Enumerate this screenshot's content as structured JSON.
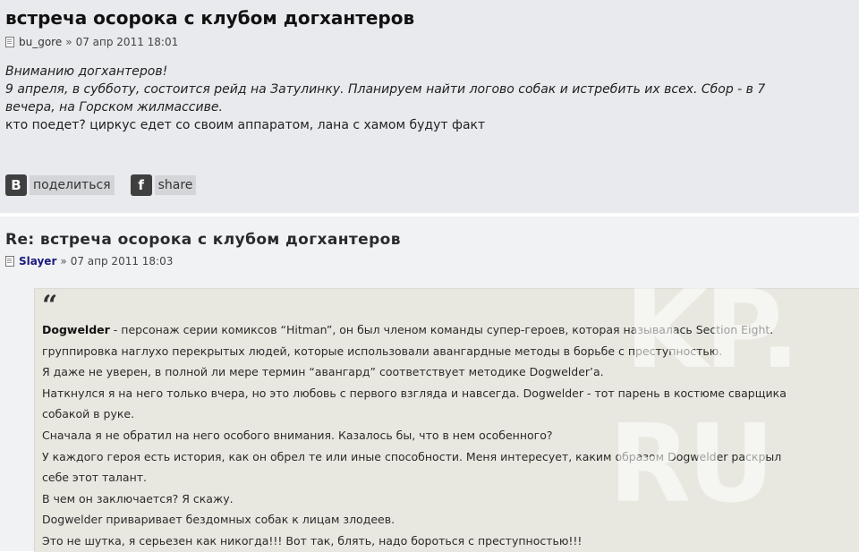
{
  "post1": {
    "title": "встреча осорока с клубом догхантеров",
    "author": "bu_gore",
    "separator": "»",
    "date": "07 апр 2011 18:01",
    "lines": [
      "Вниманию догхантеров!",
      "9 апреля, в субботу, состоится рейд на Затулинку. Планируем найти логово собак и истребить их всех. Сбор - в 7",
      "вечера, на Горском жилмассиве.",
      "кто поедет? циркус едет со своим аппаратом, лана с хамом будут факт"
    ],
    "share": {
      "vk_icon": "В",
      "vk_label": "поделиться",
      "fb_icon": "f",
      "fb_label": "share"
    }
  },
  "post2": {
    "title": "Re: встреча осорока с клубом догхантеров",
    "author": "Slayer",
    "separator": "»",
    "date": "07 апр 2011 18:03",
    "quote": {
      "mark": "“",
      "first_bold": "Dogwelder",
      "lines": [
        " - персонаж серии комиксов “Hitman”, он был членом команды супер-героев, которая называлась Section Eight.",
        "группировка наглухо перекрытых людей, которые использовали авангардные методы в борьбе с преступностью.",
        "Я даже не уверен, в полной ли мере термин “авангард” соответствует методике Dogwelder’a.",
        "Наткнулся я на него только вчера, но это любовь с первого взгляда и навсегда. Dogwelder - тот парень в костюме сварщика",
        "собакой в руке.",
        "Сначала я не обратил на него особого внимания. Казалось бы, что в нем особенного?",
        "У каждого героя есть история, как он обрел те или иные способности. Меня интересует, каким образом Dogwelder раскрыл",
        "себе этот талант.",
        "В чем он заключается? Я скажу.",
        "Dogwelder приваривает бездомных собак к лицам злодеев.",
        "Это не шутка, я серьезен как никогда!!! Вот так, блять, надо бороться с преступностью!!!"
      ]
    }
  },
  "watermark": {
    "line1": "KP.",
    "line2": "RU"
  },
  "colors": {
    "post_bg": "#e9eaed",
    "reply_bg": "#f1f2f4",
    "quote_bg": "#e9e8e0",
    "author_link": "#1a1a80"
  },
  "icons": {
    "post": "document-icon",
    "vk": "vk-icon",
    "facebook": "facebook-icon"
  }
}
